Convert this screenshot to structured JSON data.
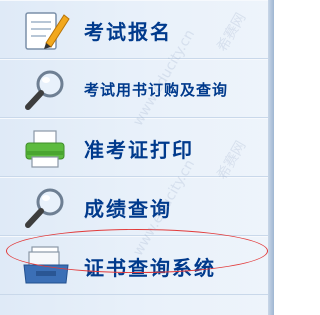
{
  "menu": {
    "items": [
      {
        "label": "考试报名",
        "icon": "pencil-notepad-icon"
      },
      {
        "label": "考试用书订购及查询",
        "icon": "magnifier-icon"
      },
      {
        "label": "准考证打印",
        "icon": "printer-icon"
      },
      {
        "label": "成绩查询",
        "icon": "magnifier-icon"
      },
      {
        "label": "证书查询系统",
        "icon": "inbox-tray-icon"
      }
    ]
  },
  "watermark": {
    "text": "希赛网",
    "url": "www.educity.cn"
  },
  "colors": {
    "label": "#003a8c",
    "highlight": "#e23b3b"
  }
}
